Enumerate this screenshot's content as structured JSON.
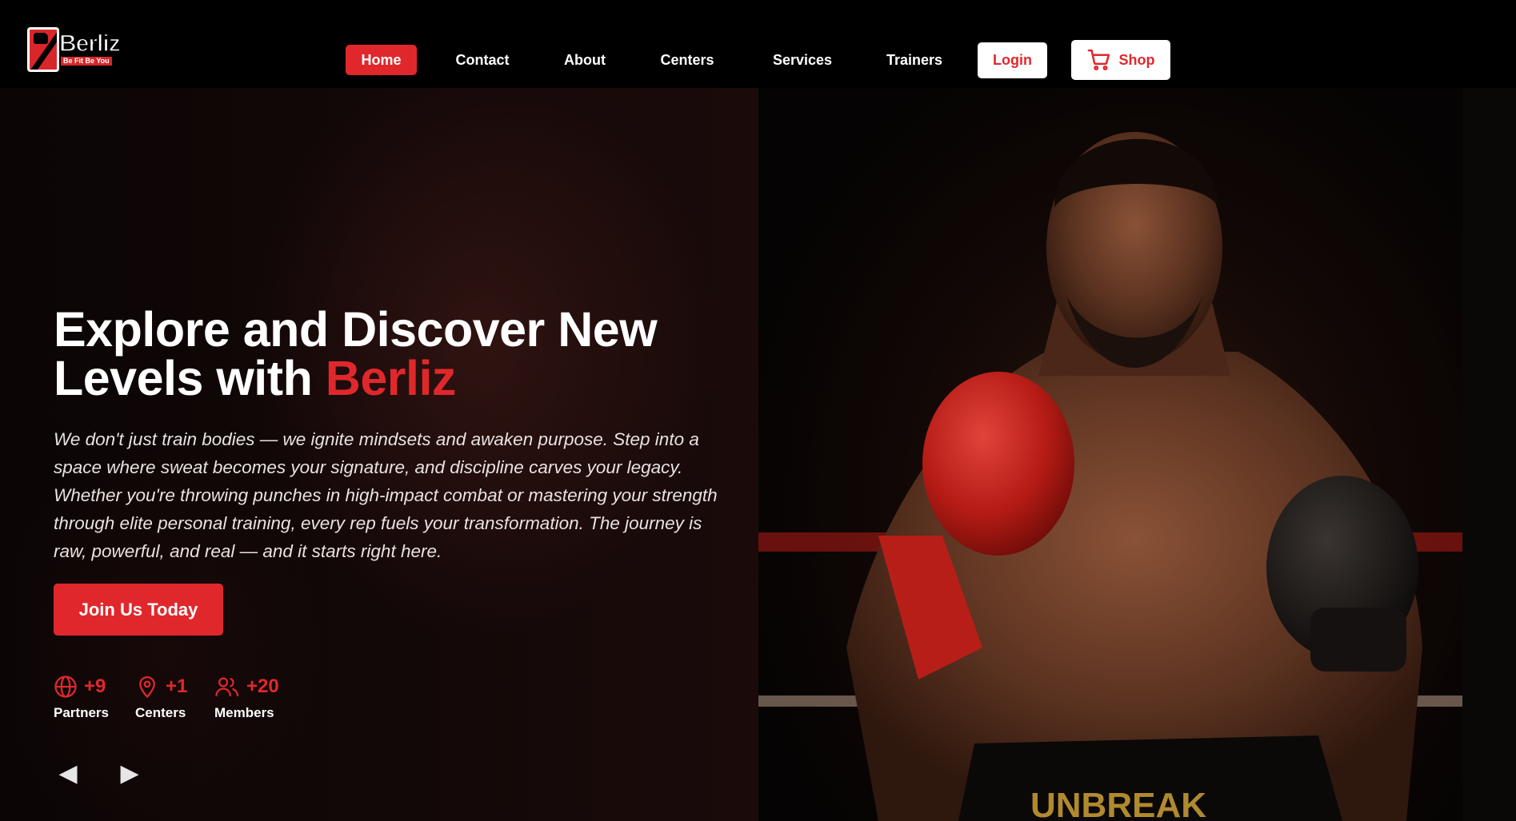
{
  "brand": {
    "name": "Berliz",
    "tagline": "Be Fit Be You",
    "accent_color": "#e0282c"
  },
  "nav": {
    "items": [
      {
        "label": "Home",
        "active": true
      },
      {
        "label": "Contact",
        "active": false
      },
      {
        "label": "About",
        "active": false
      },
      {
        "label": "Centers",
        "active": false
      },
      {
        "label": "Services",
        "active": false
      },
      {
        "label": "Trainers",
        "active": false
      }
    ],
    "login_label": "Login",
    "shop_label": "Shop",
    "shop_icon": "cart-icon"
  },
  "hero": {
    "headline_line1": "Explore and Discover New",
    "headline_line2_prefix": "Levels with ",
    "headline_accent": "Berliz",
    "description": "We don't just train bodies — we ignite mindsets and awaken purpose. Step into a space where sweat becomes your signature, and discipline carves your legacy. Whether you're throwing punches in high-impact combat or mastering your strength through elite personal training, every rep fuels your transformation. The journey is raw, powerful, and real — and it starts right here.",
    "cta_label": "Join Us Today",
    "stats": [
      {
        "icon": "globe-icon",
        "value": "+9",
        "label": "Partners"
      },
      {
        "icon": "location-pin-icon",
        "value": "+1",
        "label": "Centers"
      },
      {
        "icon": "users-icon",
        "value": "+20",
        "label": "Members"
      }
    ],
    "prev_arrow": "◀",
    "next_arrow": "▶",
    "photo_shorts_text": "UNBREAK"
  }
}
